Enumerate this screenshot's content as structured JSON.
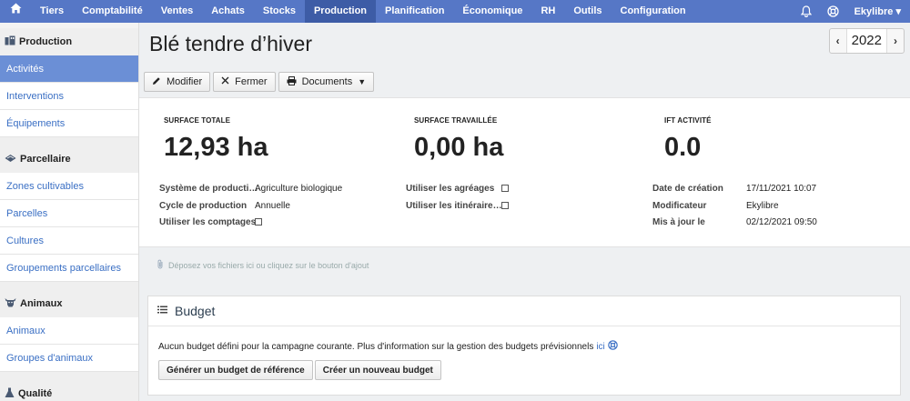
{
  "topbar": {
    "home_icon": "home-icon",
    "items": [
      {
        "label": "Tiers"
      },
      {
        "label": "Comptabilité"
      },
      {
        "label": "Ventes"
      },
      {
        "label": "Achats"
      },
      {
        "label": "Stocks"
      },
      {
        "label": "Production",
        "active": true
      },
      {
        "label": "Planification"
      },
      {
        "label": "Économique"
      },
      {
        "label": "RH"
      },
      {
        "label": "Outils"
      },
      {
        "label": "Configuration"
      }
    ],
    "user": "Ekylibre",
    "colors": {
      "bar": "#5677c6",
      "active": "#3d5ca6"
    }
  },
  "sidebar": {
    "sections": [
      {
        "title": "Production",
        "icon": "production-icon",
        "items": [
          {
            "label": "Activités",
            "active": true
          },
          {
            "label": "Interventions"
          },
          {
            "label": "Équipements"
          }
        ]
      },
      {
        "title": "Parcellaire",
        "icon": "parcel-icon",
        "items": [
          {
            "label": "Zones cultivables"
          },
          {
            "label": "Parcelles"
          },
          {
            "label": "Cultures"
          },
          {
            "label": "Groupements parcellaires"
          }
        ]
      },
      {
        "title": "Animaux",
        "icon": "cow-icon",
        "items": [
          {
            "label": "Animaux"
          },
          {
            "label": "Groupes d'animaux"
          }
        ]
      },
      {
        "title": "Qualité",
        "icon": "flask-icon",
        "items": []
      }
    ]
  },
  "main": {
    "title": "Blé tendre d’hiver",
    "year": "2022",
    "toolbar": {
      "modify": "Modifier",
      "close": "Fermer",
      "documents": "Documents"
    },
    "kpis": [
      {
        "label": "SURFACE TOTALE",
        "value": "12,93 ha"
      },
      {
        "label": "SURFACE TRAVAILLÉE",
        "value": "0,00 ha"
      },
      {
        "label": "IFT ACTIVITÉ",
        "value": "0.0"
      }
    ],
    "fields": {
      "production_system_label": "Système de producti…",
      "production_system_value": "Agriculture biologique",
      "production_cycle_label": "Cycle de production",
      "production_cycle_value": "Annuelle",
      "use_counts_label": "Utiliser les comptages",
      "use_counts_checked": false,
      "use_approvals_label": "Utiliser les agréages",
      "use_approvals_checked": false,
      "use_itineraries_label": "Utiliser les itinéraire…",
      "use_itineraries_checked": false,
      "created_label": "Date de création",
      "created_value": "17/11/2021 10:07",
      "modifier_label": "Modificateur",
      "modifier_value": "Ekylibre",
      "updated_label": "Mis à jour le",
      "updated_value": "02/12/2021 09:50"
    },
    "dropzone": "Déposez vos fichiers ici ou cliquez sur le bouton d'ajout",
    "budget": {
      "title": "Budget",
      "message": "Aucun budget défini pour la campagne courante. Plus d'information sur la gestion des budgets prévisionnels",
      "link": "ici",
      "generate_button": "Générer un budget de référence",
      "create_button": "Créer un nouveau budget"
    }
  }
}
